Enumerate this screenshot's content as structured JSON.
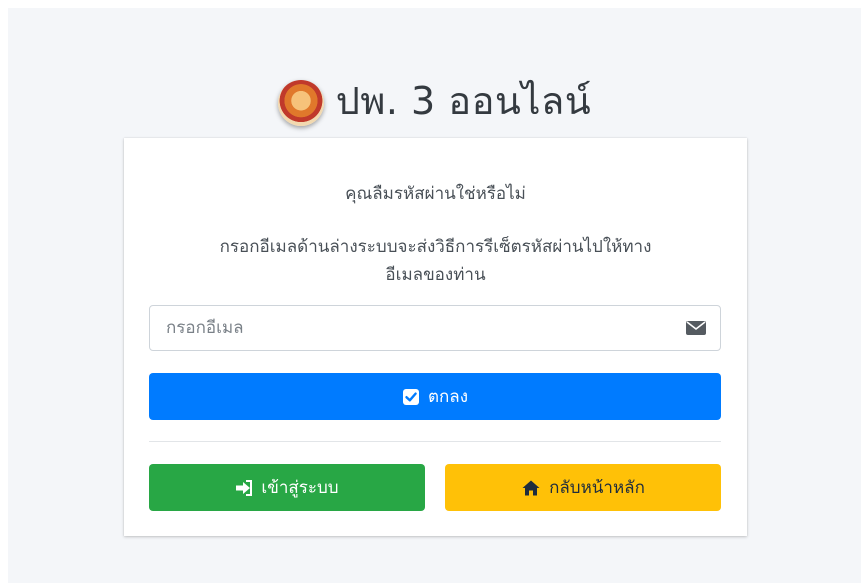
{
  "brand": {
    "title": "ปพ. 3 ออนไลน์"
  },
  "card": {
    "prompt": "คุณลืมรหัสผ่านใช่หรือไม่",
    "instruction_line1": "กรอกอีเมลด้านล่างระบบจะส่งวิธีการรีเซ็ตรหัสผ่านไปให้ทาง",
    "instruction_line2": "อีเมลของท่าน",
    "email": {
      "placeholder": "กรอกอีเมล",
      "value": ""
    },
    "submit_label": "ตกลง",
    "login_label": "เข้าสู่ระบบ",
    "home_label": "กลับหน้าหลัก"
  },
  "icons": {
    "logo": "school-emblem-logo",
    "email": "envelope-icon",
    "submit": "check-square-icon",
    "login": "sign-in-icon",
    "home": "home-icon"
  },
  "colors": {
    "primary": "#007bff",
    "success": "#28a745",
    "warning": "#ffc107",
    "background": "#f4f6f9"
  }
}
